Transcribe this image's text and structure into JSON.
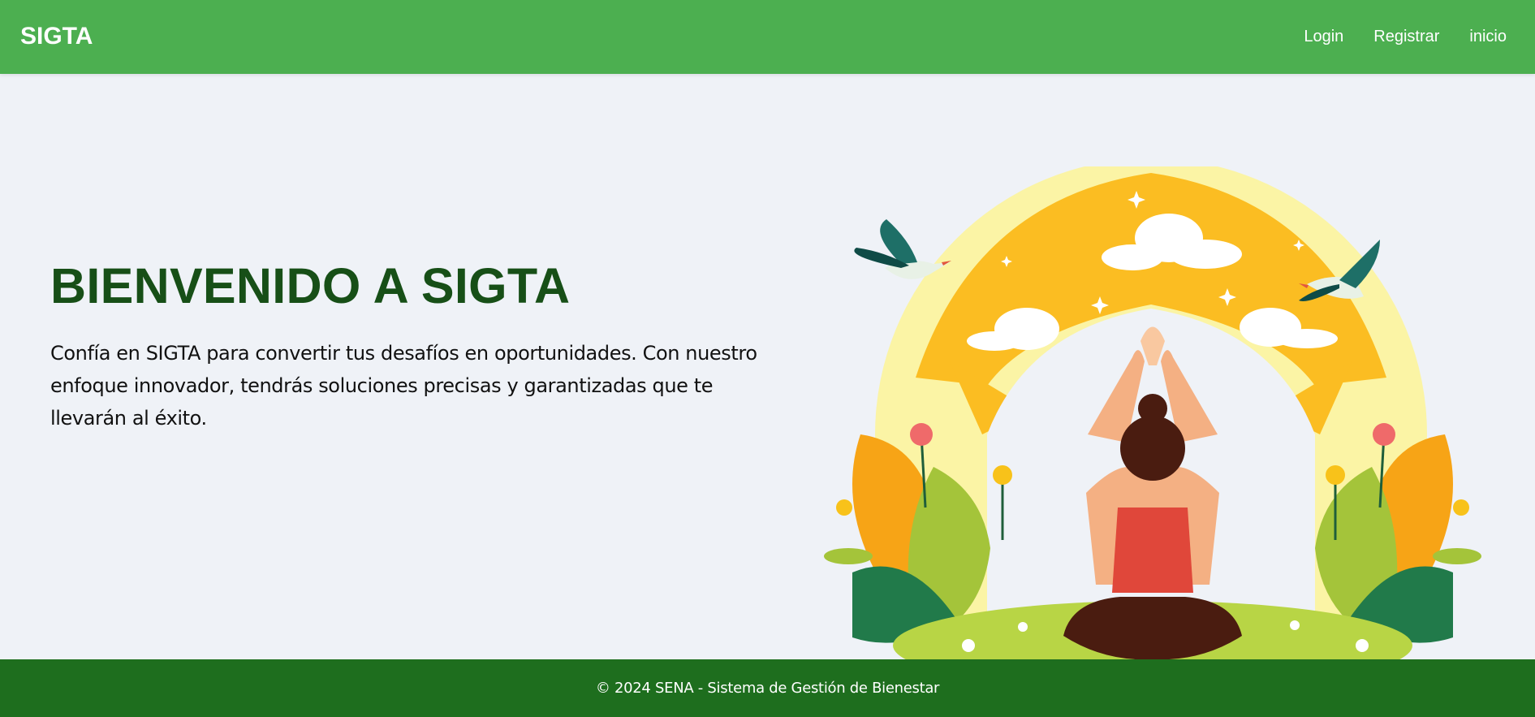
{
  "navbar": {
    "brand": "SIGTA",
    "links": [
      "Login",
      "Registrar",
      "inicio"
    ],
    "color": "#4caf50"
  },
  "hero": {
    "title": "BIENVENIDO A SIGTA",
    "text": "Confía en SIGTA para convertir tus desafíos en oportunidades. Con nuestro enfoque innovador, tendrás soluciones precisas y garantizadas que te llevarán al éxito.",
    "title_color": "#174f17",
    "illustration": "yoga-meditation-illustration"
  },
  "footer": {
    "text": "© 2024 SENA - Sistema de Gestión de Bienestar",
    "color": "#1e6e1e"
  }
}
